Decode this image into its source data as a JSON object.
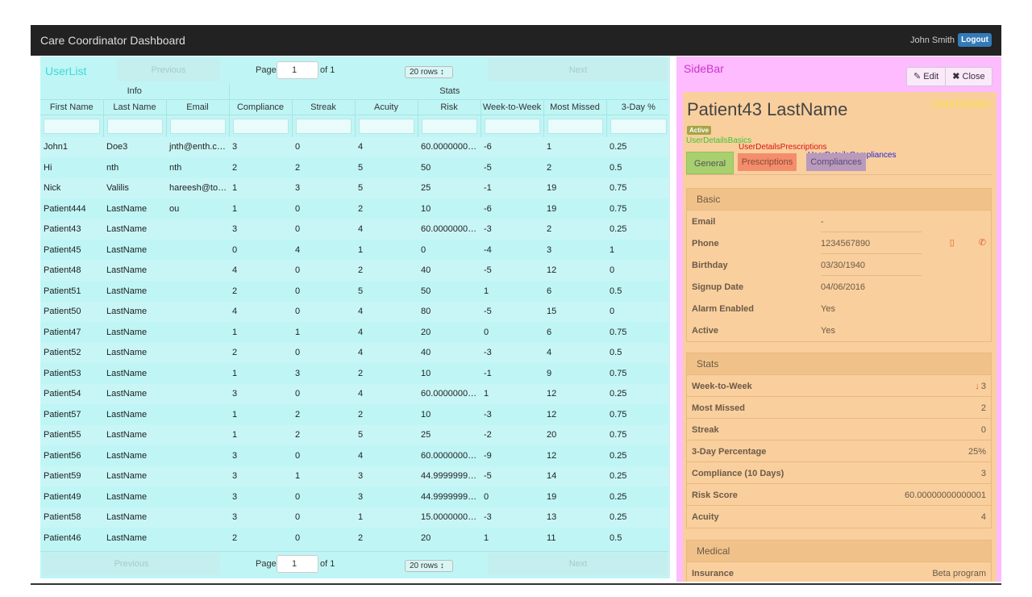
{
  "navbar": {
    "title": "Care Coordinator Dashboard",
    "user": "John Smith",
    "logout": "Logout"
  },
  "userlist": {
    "title": "UserList",
    "pager": {
      "previous": "Previous",
      "page_label": "Page",
      "page_value": "1",
      "of_label": "of 1",
      "rows_label": "20 rows",
      "next": "Next"
    },
    "group_headers": [
      "Info",
      "Stats"
    ],
    "columns": [
      "First Name",
      "Last Name",
      "Email",
      "Compliance",
      "Streak",
      "Acuity",
      "Risk",
      "Week-to-Week",
      "Most Missed",
      "3-Day %"
    ],
    "rows": [
      [
        "John1",
        "Doe3",
        "jnth@enth.com",
        "3",
        "0",
        "4",
        "60.00000000000001",
        "-6",
        "1",
        "0.25"
      ],
      [
        "Hi",
        "nth",
        "nth",
        "2",
        "2",
        "5",
        "50",
        "-5",
        "2",
        "0.5"
      ],
      [
        "Nick",
        "Valilis",
        "hareesh@tourofhealth.com",
        "1",
        "3",
        "5",
        "25",
        "-1",
        "19",
        "0.75"
      ],
      [
        "Patient444",
        "LastName",
        "ou",
        "1",
        "0",
        "2",
        "10",
        "-6",
        "19",
        "0.75"
      ],
      [
        "Patient43",
        "LastName",
        "",
        "3",
        "0",
        "4",
        "60.00000000000001",
        "-3",
        "2",
        "0.25"
      ],
      [
        "Patient45",
        "LastName",
        "",
        "0",
        "4",
        "1",
        "0",
        "-4",
        "3",
        "1"
      ],
      [
        "Patient48",
        "LastName",
        "",
        "4",
        "0",
        "2",
        "40",
        "-5",
        "12",
        "0"
      ],
      [
        "Patient51",
        "LastName",
        "",
        "2",
        "0",
        "5",
        "50",
        "1",
        "6",
        "0.5"
      ],
      [
        "Patient50",
        "LastName",
        "",
        "4",
        "0",
        "4",
        "80",
        "-5",
        "15",
        "0"
      ],
      [
        "Patient47",
        "LastName",
        "",
        "1",
        "1",
        "4",
        "20",
        "0",
        "6",
        "0.75"
      ],
      [
        "Patient52",
        "LastName",
        "",
        "2",
        "0",
        "4",
        "40",
        "-3",
        "4",
        "0.5"
      ],
      [
        "Patient53",
        "LastName",
        "",
        "1",
        "3",
        "2",
        "10",
        "-1",
        "9",
        "0.75"
      ],
      [
        "Patient54",
        "LastName",
        "",
        "3",
        "0",
        "4",
        "60.00000000000001",
        "1",
        "12",
        "0.25"
      ],
      [
        "Patient57",
        "LastName",
        "",
        "1",
        "2",
        "2",
        "10",
        "-3",
        "12",
        "0.75"
      ],
      [
        "Patient55",
        "LastName",
        "",
        "1",
        "2",
        "5",
        "25",
        "-2",
        "20",
        "0.75"
      ],
      [
        "Patient56",
        "LastName",
        "",
        "3",
        "0",
        "4",
        "60.00000000000001",
        "-9",
        "12",
        "0.25"
      ],
      [
        "Patient59",
        "LastName",
        "",
        "3",
        "1",
        "3",
        "44.99999999999999",
        "-5",
        "14",
        "0.25"
      ],
      [
        "Patient49",
        "LastName",
        "",
        "3",
        "0",
        "3",
        "44.99999999999999",
        "0",
        "19",
        "0.25"
      ],
      [
        "Patient58",
        "LastName",
        "",
        "3",
        "0",
        "1",
        "15.000000000000002",
        "-3",
        "13",
        "0.25"
      ],
      [
        "Patient46",
        "LastName",
        "",
        "2",
        "0",
        "2",
        "20",
        "1",
        "11",
        "0.5"
      ]
    ]
  },
  "sidebar": {
    "title": "SideBar",
    "edit": "Edit",
    "close": "Close",
    "details_label": "UserDetails",
    "patient_name": "Patient43 LastName",
    "status_badge": "Active",
    "debug_labels": {
      "basics": "UserDetailsBasics",
      "prescriptions": "UserDetailsPrescriptions",
      "compliances": "UserDetailsCompliances"
    },
    "tabs": {
      "general": "General",
      "prescriptions": "Prescriptions",
      "compliances": "Compliances"
    },
    "basic": {
      "title": "Basic",
      "email_label": "Email",
      "email": "-",
      "phone_label": "Phone",
      "phone": "1234567890",
      "birthday_label": "Birthday",
      "birthday": "03/30/1940",
      "signup_label": "Signup Date",
      "signup": "04/06/2016",
      "alarm_label": "Alarm Enabled",
      "alarm": "Yes",
      "active_label": "Active",
      "active": "Yes"
    },
    "stats": {
      "title": "Stats",
      "wtw_label": "Week-to-Week",
      "wtw": "3",
      "most_missed_label": "Most Missed",
      "most_missed": "2",
      "streak_label": "Streak",
      "streak": "0",
      "three_day_label": "3-Day Percentage",
      "three_day": "25%",
      "compliance_label": "Compliance (10 Days)",
      "compliance": "3",
      "risk_label": "Risk Score",
      "risk": "60.00000000000001",
      "acuity_label": "Acuity",
      "acuity": "4"
    },
    "medical": {
      "title": "Medical",
      "insurance_label": "Insurance",
      "insurance": "Beta program"
    }
  },
  "icons": {
    "edit": "pencil-icon",
    "close": "x-icon",
    "mobile": "mobile-phone-icon",
    "phone": "phone-icon",
    "wtw_arrow": "arrow-down-icon",
    "rows_select": "up-down-caret-icon"
  },
  "colors": {
    "navbar": "#222222",
    "userlist_bg": "#bff5f5",
    "sidebar_bg": "#ffbbff",
    "details_bg": "#f9cf9d",
    "logout": "#337ab7",
    "active_badge": "#a5a546"
  }
}
